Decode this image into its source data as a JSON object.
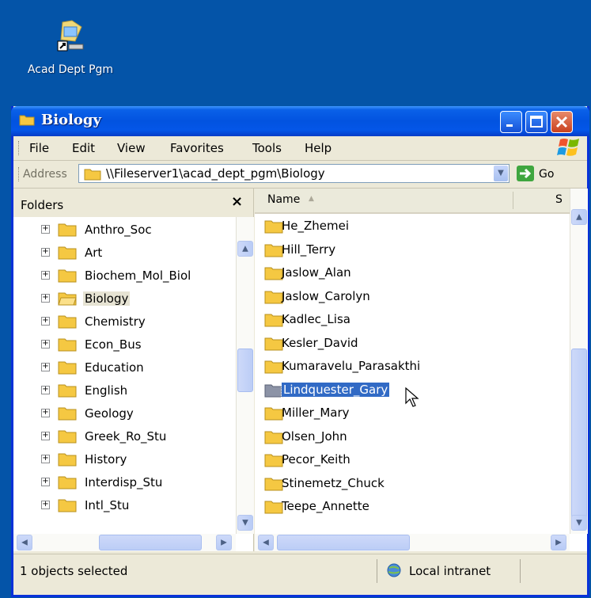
{
  "desktop": {
    "shortcut_label": "Acad Dept Pgm"
  },
  "window": {
    "title": "Biology"
  },
  "menu": [
    "File",
    "Edit",
    "View",
    "Favorites",
    "Tools",
    "Help"
  ],
  "address": {
    "label": "Address",
    "path": "\\\\Fileserver1\\acad_dept_pgm\\Biology",
    "go_label": "Go"
  },
  "folders_pane": {
    "title": "Folders",
    "close_symbol": "×",
    "items": [
      "Anthro_Soc",
      "Art",
      "Biochem_Mol_Biol",
      "Biology",
      "Chemistry",
      "Econ_Bus",
      "Education",
      "English",
      "Geology",
      "Greek_Ro_Stu",
      "History",
      "Interdisp_Stu",
      "Intl_Stu"
    ],
    "selected": "Biology"
  },
  "file_list": {
    "columns": {
      "name": "Name",
      "size_partial": "S"
    },
    "items": [
      "He_Zhemei",
      "Hill_Terry",
      "Jaslow_Alan",
      "Jaslow_Carolyn",
      "Kadlec_Lisa",
      "Kesler_David",
      "Kumaravelu_Parasakthi",
      "Lindquester_Gary",
      "Miller_Mary",
      "Olsen_John",
      "Pecor_Keith",
      "Stinemetz_Chuck",
      "Teepe_Annette"
    ],
    "selected": "Lindquester_Gary"
  },
  "status": {
    "selection": "1 objects selected",
    "zone": "Local intranet"
  },
  "colors": {
    "titlebar": "#0253e0",
    "desktop": "#0454a8",
    "selection": "#316ac5",
    "folder": "#f5c842"
  }
}
